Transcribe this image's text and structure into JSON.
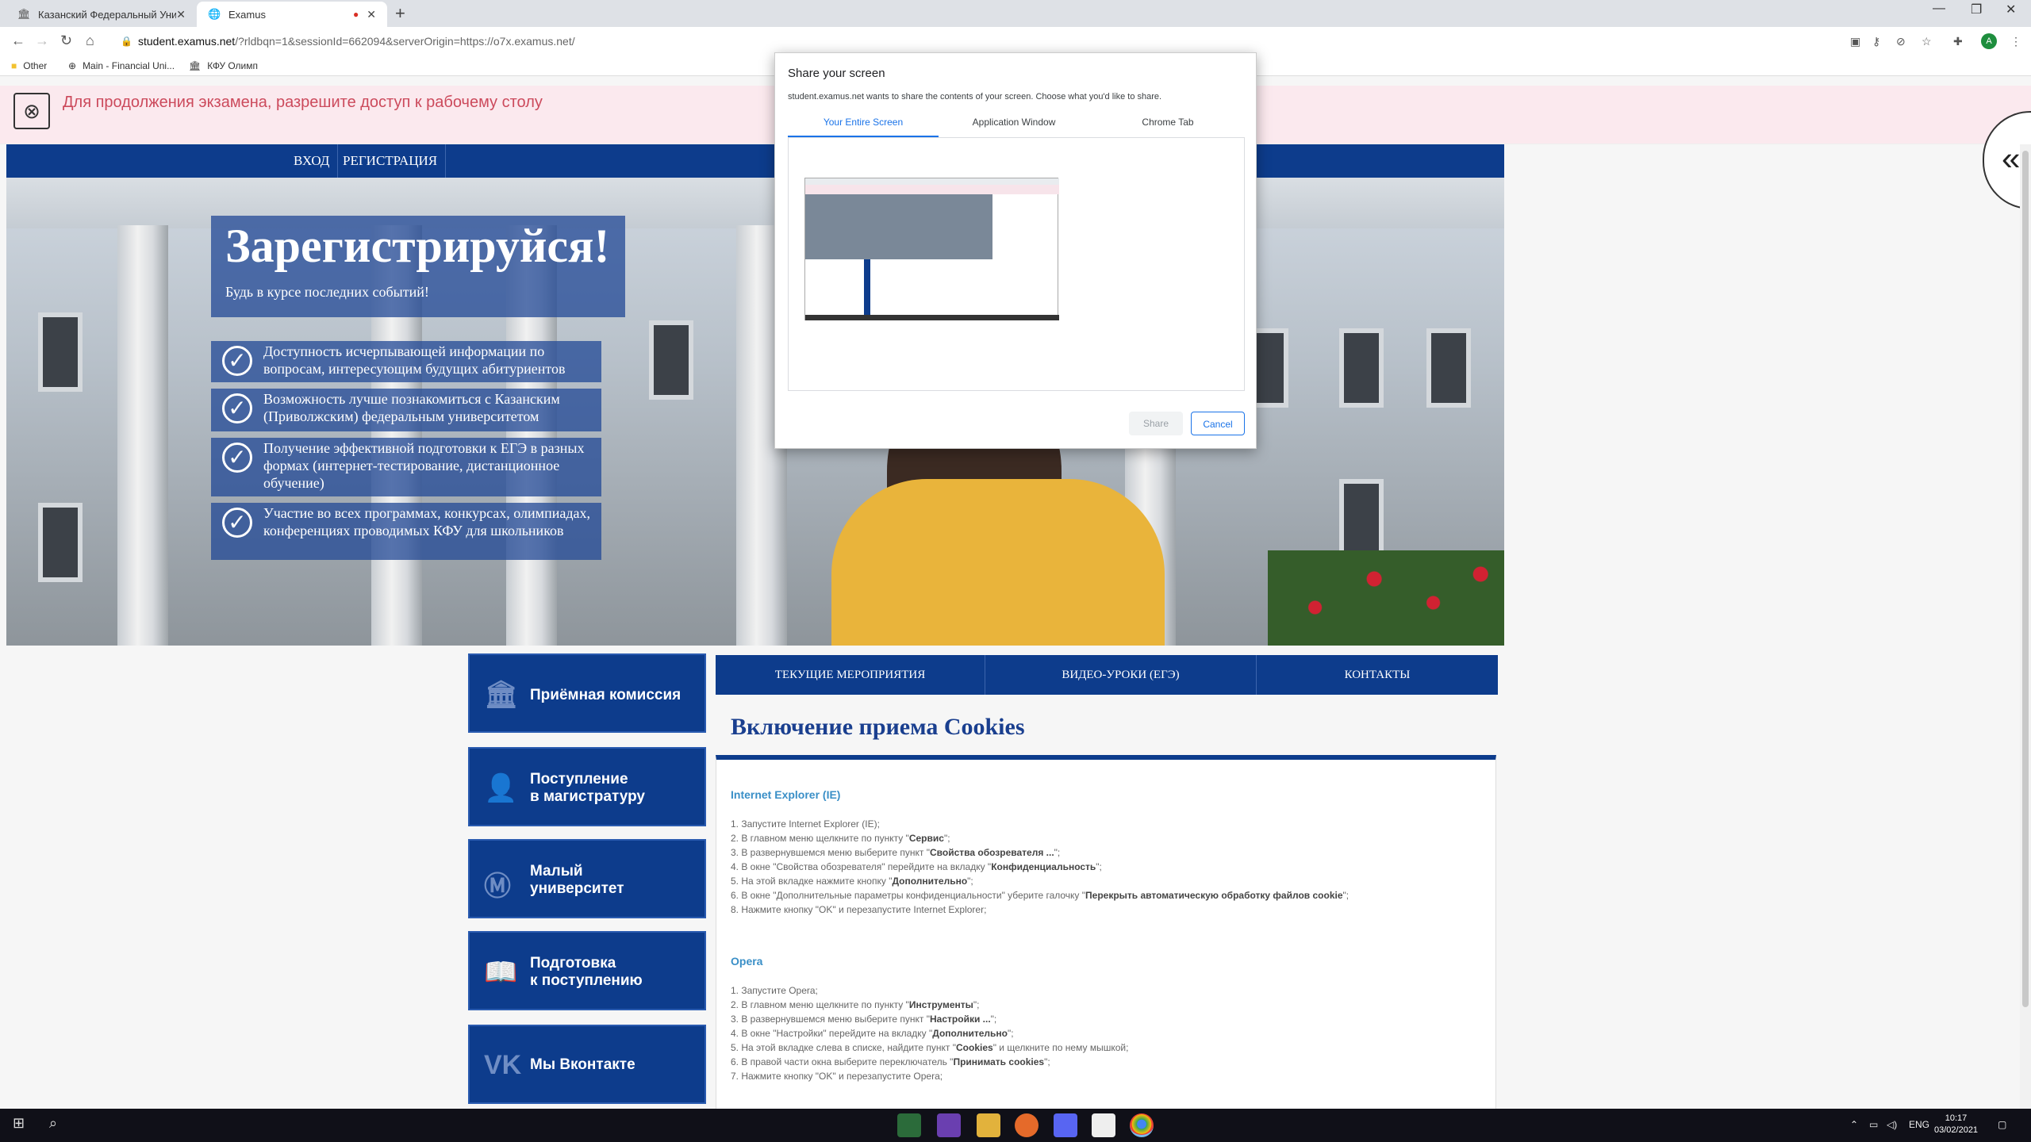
{
  "browser": {
    "tabs": [
      {
        "title": "Казанский Федеральный Униве...",
        "close": "✕"
      },
      {
        "title": "Examus",
        "close": "✕"
      }
    ],
    "new_tab": "+",
    "window_controls": {
      "minimize": "—",
      "restore": "❐",
      "close": "✕"
    },
    "url_host": "student.examus.net",
    "url_rest": "/?rldbqn=1&sessionId=662094&serverOrigin=https://o7x.examus.net/",
    "bookmarks": [
      {
        "label": "Other",
        "icon": "folder-icon"
      },
      {
        "label": "Main - Financial Uni...",
        "icon": "globe-icon"
      },
      {
        "label": "КФУ Олимп",
        "icon": "building-icon"
      }
    ]
  },
  "banner": {
    "message": "Для продолжения экзамена, разрешите доступ к рабочему столу"
  },
  "site_nav": {
    "items": [
      "ВХОД",
      "РЕГИСТРАЦИЯ"
    ]
  },
  "hero": {
    "title": "Зарегистрируйся!",
    "subtitle": "Будь в курсе последних событий!",
    "features": [
      "Доступность исчерпывающей информации по вопросам, интересующим будущих абитуриентов",
      "Возможность лучше познакомиться с Казанским (Приволжским) федеральным университетом",
      "Получение эффективной подготовки к ЕГЭ в разных формах (интернет-тестирование, дистанционное обучение)",
      "Участие во всех программах, конкурсах, олимпиадах, конференциях проводимых КФУ для школьников"
    ]
  },
  "share_dialog": {
    "title": "Share your screen",
    "description": "student.examus.net wants to share the contents of your screen. Choose what you'd like to share.",
    "tabs": [
      "Your Entire Screen",
      "Application Window",
      "Chrome Tab"
    ],
    "selected_tab": "Your Entire Screen",
    "share_label": "Share",
    "cancel_label": "Cancel"
  },
  "side_widget": {
    "label": "«"
  },
  "left_menu": [
    {
      "label": "Приёмная комиссия",
      "icon": "building-icon"
    },
    {
      "label": "Поступление в магистратуру",
      "line1": "Поступление",
      "line2": "в магистратуру",
      "icon": "graduate-icon"
    },
    {
      "label": "Малый университет",
      "line1": "Малый",
      "line2": "университет",
      "icon": "university-logo-icon"
    },
    {
      "label": "Подготовка к поступлению",
      "line1": "Подготовка",
      "line2": "к поступлению",
      "icon": "book-icon"
    },
    {
      "label": "Мы Вконтакте",
      "icon": "vk-icon"
    }
  ],
  "top_tabs": [
    "ТЕКУЩИЕ МЕРОПРИЯТИЯ",
    "ВИДЕО-УРОКИ (ЕГЭ)",
    "КОНТАКТЫ"
  ],
  "content": {
    "title": "Включение приема Cookies",
    "sections": [
      {
        "name": "Internet Explorer (IE)",
        "steps": [
          [
            "1. Запустите Internet Explorer (IE);"
          ],
          [
            "2. В главном меню щелкните по пункту \"",
            "Сервис",
            "\";"
          ],
          [
            "3. В развернувшемся меню выберите пункт \"",
            "Свойства обозревателя ...",
            "\";"
          ],
          [
            "4. В окне \"Свойства обозревателя\" перейдите на вкладку \"",
            "Конфиденциальность",
            "\";"
          ],
          [
            "5. На этой вкладке нажмите кнопку \"",
            "Дополнительно",
            "\";"
          ],
          [
            "6. В окне \"Дополнительные параметры конфиденциальности\" уберите галочку \"",
            "Перекрыть автоматическую обработку файлов cookie",
            "\";"
          ],
          [
            "8. Нажмите кнопку \"OK\" и перезапустите Internet Explorer;"
          ]
        ]
      },
      {
        "name": "Opera",
        "steps": [
          [
            "1. Запустите Opera;"
          ],
          [
            "2. В главном меню щелкните по пункту \"",
            "Инструменты",
            "\";"
          ],
          [
            "3. В развернувшемся меню выберите пункт \"",
            "Настройки ...",
            "\";"
          ],
          [
            "4. В окне \"Настройки\" перейдите на вкладку \"",
            "Дополнительно",
            "\";"
          ],
          [
            "5. На этой вкладке слева в списке, найдите пункт \"",
            "Cookies",
            "\" и щелкните по нему мышкой;"
          ],
          [
            "6. В правой части окна выберите переключатель \"",
            "Принимать cookies",
            "\";"
          ],
          [
            "7. Нажмите кнопку \"OK\" и перезапустите Opera;"
          ]
        ]
      }
    ]
  },
  "taskbar": {
    "language": "ENG",
    "time": "10:17",
    "date": "03/02/2021"
  },
  "colors": {
    "site_blue": "#0d3c8c",
    "banner_bg": "#fbe9ee",
    "banner_text": "#cc4a5c",
    "dialog_accent": "#1a73e8"
  }
}
